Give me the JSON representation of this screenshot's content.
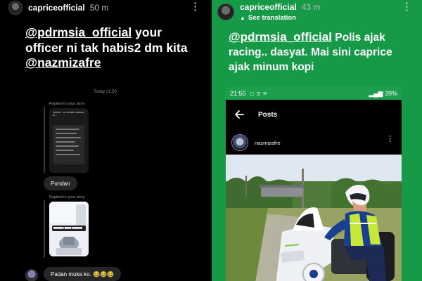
{
  "left_story": {
    "username": "capriceofficial",
    "time": "50 m",
    "caption_mention": "@pdrmsia_official",
    "caption_text": " your officer ni tak habis2 dm kita ",
    "caption_mention2": "@nazmizafre",
    "dm_timestamp": "Today 21:50",
    "replied_1": "Replied to your story",
    "thumb1_text": "hmmm... eo wonder selama ni ...",
    "reply_1": "Pondan",
    "replied_2": "Replied to your story",
    "reply_2": "Padan muka ko. 😂😂😂"
  },
  "right_story": {
    "username": "capriceofficial",
    "time": "43 m",
    "see_translation": "See translation",
    "caption_mention": "@pdrmsia_official",
    "caption_text": " Polis ajak racing.. dasyat. Mai sini caprice ajak minum kopi",
    "screenshot": {
      "status_time": "21:55",
      "battery": "39%",
      "app_title": "Posts",
      "post_username": "nazmizafre"
    }
  },
  "icons": [
    "more-vertical-icon",
    "translate-icon",
    "back-arrow-icon",
    "signal-icon",
    "battery-icon"
  ],
  "colors": {
    "left_bg": "#000000",
    "right_bg": "#179a47",
    "text": "#ffffff"
  }
}
